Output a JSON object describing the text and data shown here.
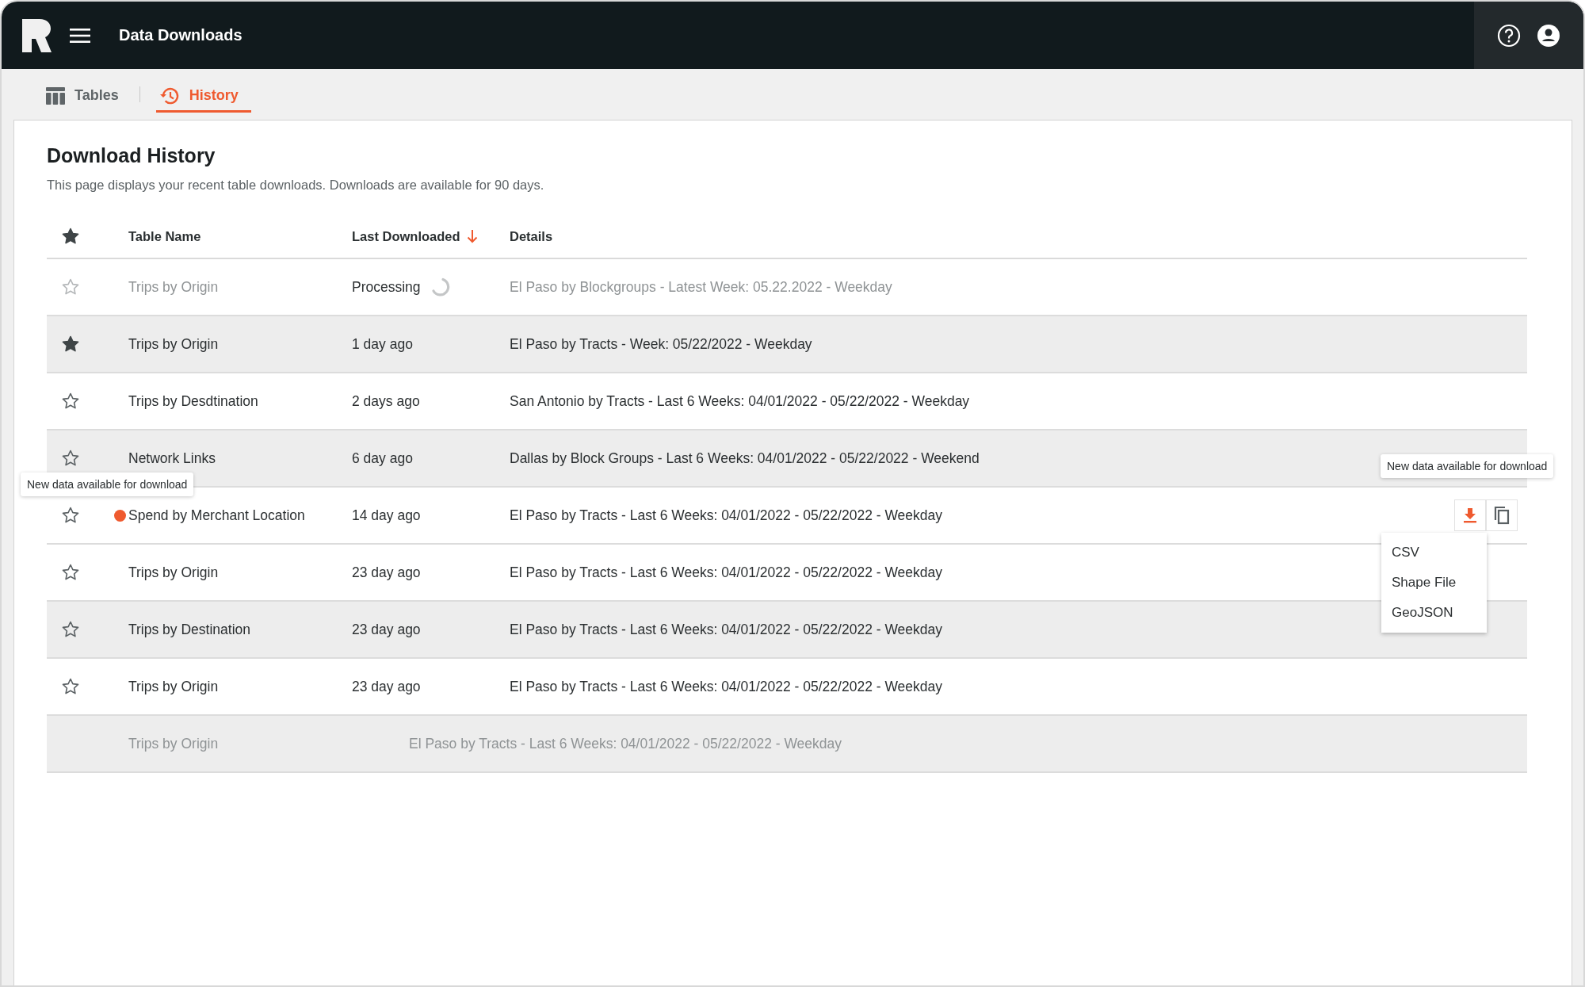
{
  "app": {
    "title": "Data Downloads"
  },
  "tabs": [
    {
      "label": "Tables",
      "selected": false
    },
    {
      "label": "History",
      "selected": true
    }
  ],
  "page": {
    "title": "Download History",
    "description": "This page displays your recent table downloads. Downloads are available for 90 days."
  },
  "table": {
    "columns": [
      {
        "label": "Table Name",
        "sorted": false
      },
      {
        "label": "Last Downloaded",
        "sorted": true
      },
      {
        "label": "Details",
        "sorted": false
      }
    ],
    "rows": [
      {
        "kind": "processing",
        "starred": false,
        "highlighted": false,
        "disabled": true,
        "new_data": false,
        "table_name": "Trips by Origin",
        "last_downloaded": "Processing",
        "details": "El Paso by Blockgroups - Latest Week: 05.22.2022 - Weekday"
      },
      {
        "kind": "normal",
        "starred": true,
        "highlighted": true,
        "disabled": false,
        "new_data": false,
        "table_name": "Trips by Origin",
        "last_downloaded": "1 day ago",
        "details": "El Paso by Tracts - Week: 05/22/2022 - Weekday"
      },
      {
        "kind": "normal",
        "starred": false,
        "highlighted": false,
        "disabled": false,
        "new_data": false,
        "table_name": "Trips by Desdtination",
        "last_downloaded": "2 days ago",
        "details": "San Antonio by Tracts - Last 6 Weeks: 04/01/2022 - 05/22/2022 - Weekday"
      },
      {
        "kind": "normal",
        "starred": false,
        "highlighted": true,
        "disabled": false,
        "new_data": false,
        "table_name": "Network Links",
        "last_downloaded": "6 day ago",
        "details": "Dallas by Block Groups - Last 6 Weeks: 04/01/2022 - 05/22/2022 - Weekend"
      },
      {
        "kind": "normal",
        "starred": false,
        "highlighted": false,
        "disabled": false,
        "new_data": true,
        "new_data_tooltip": "New data available for download",
        "table_name": "Spend by Merchant Location",
        "last_downloaded": "14 day ago",
        "details": "El Paso by Tracts - Last 6 Weeks: 04/01/2022 - 05/22/2022 - Weekday",
        "actions": {
          "tooltip": "New data available for download",
          "menu": [
            "CSV",
            "Shape File",
            "GeoJSON"
          ]
        }
      },
      {
        "kind": "normal",
        "starred": false,
        "highlighted": false,
        "disabled": false,
        "new_data": false,
        "table_name": "Trips by Origin",
        "last_downloaded": "23 day ago",
        "details": "El Paso by Tracts - Last 6 Weeks: 04/01/2022 - 05/22/2022 - Weekday"
      },
      {
        "kind": "normal",
        "starred": false,
        "highlighted": true,
        "disabled": false,
        "new_data": false,
        "table_name": "Trips by Destination",
        "last_downloaded": "23 day ago",
        "details": "El Paso by Tracts - Last 6 Weeks: 04/01/2022 - 05/22/2022 - Weekday"
      },
      {
        "kind": "normal",
        "starred": false,
        "highlighted": false,
        "disabled": false,
        "new_data": false,
        "table_name": "Trips by Origin",
        "last_downloaded": "23 day ago",
        "details": "El Paso by Tracts - Last 6 Weeks: 04/01/2022 - 05/22/2022 - Weekday"
      },
      {
        "kind": "expired",
        "highlighted": true,
        "disabled": true,
        "table_name": "Trips by Origin",
        "details": "El Paso by Tracts - Last 6 Weeks: 04/01/2022 - 05/22/2022 - Weekday"
      }
    ]
  }
}
